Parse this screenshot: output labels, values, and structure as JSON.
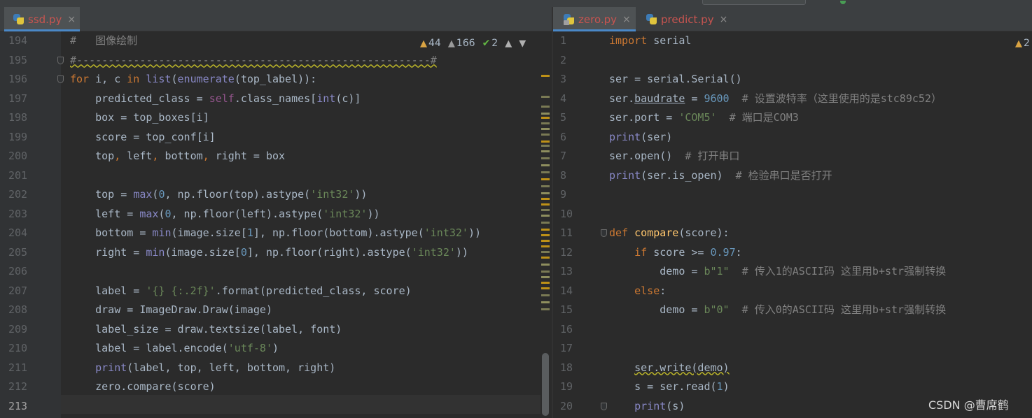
{
  "left_pane": {
    "tab": {
      "label": "ssd.py",
      "close": "×"
    },
    "inspections": {
      "warnings": "44",
      "weak_warnings": "166",
      "typos": "2"
    },
    "line_numbers": [
      "194",
      "195",
      "196",
      "197",
      "198",
      "199",
      "200",
      "201",
      "202",
      "203",
      "204",
      "205",
      "206",
      "207",
      "208",
      "209",
      "210",
      "211",
      "212",
      "213"
    ],
    "lines": [
      [
        {
          "t": "#   图像绘制",
          "c": "cm"
        }
      ],
      [
        {
          "t": "#--------------------------------------------------------#",
          "c": "cm sq"
        }
      ],
      [
        {
          "t": "for",
          "c": "kw"
        },
        {
          "t": " i, c "
        },
        {
          "t": "in",
          "c": "kw"
        },
        {
          "t": " "
        },
        {
          "t": "list",
          "c": "bi"
        },
        {
          "t": "("
        },
        {
          "t": "enumerate",
          "c": "bi"
        },
        {
          "t": "(top_label)):"
        }
      ],
      [
        {
          "t": "    predicted_class = "
        },
        {
          "t": "self",
          "c": "slf"
        },
        {
          "t": ".class_names["
        },
        {
          "t": "int",
          "c": "bi"
        },
        {
          "t": "(c)]"
        }
      ],
      [
        {
          "t": "    box = top_boxes[i]"
        }
      ],
      [
        {
          "t": "    score = top_conf[i]"
        }
      ],
      [
        {
          "t": "    top"
        },
        {
          "t": ",",
          "c": "kw"
        },
        {
          "t": " left"
        },
        {
          "t": ",",
          "c": "kw"
        },
        {
          "t": " bottom"
        },
        {
          "t": ",",
          "c": "kw"
        },
        {
          "t": " right = box"
        }
      ],
      [],
      [
        {
          "t": "    top = "
        },
        {
          "t": "max",
          "c": "bi"
        },
        {
          "t": "("
        },
        {
          "t": "0",
          "c": "num"
        },
        {
          "t": ","
        },
        {
          "t": " np.floor(top).astype("
        },
        {
          "t": "'int32'",
          "c": "str"
        },
        {
          "t": "))"
        }
      ],
      [
        {
          "t": "    left = "
        },
        {
          "t": "max",
          "c": "bi"
        },
        {
          "t": "("
        },
        {
          "t": "0",
          "c": "num"
        },
        {
          "t": ","
        },
        {
          "t": " np.floor(left).astype("
        },
        {
          "t": "'int32'",
          "c": "str"
        },
        {
          "t": "))"
        }
      ],
      [
        {
          "t": "    bottom = "
        },
        {
          "t": "min",
          "c": "bi"
        },
        {
          "t": "(image.size["
        },
        {
          "t": "1",
          "c": "num"
        },
        {
          "t": "],"
        },
        {
          "t": " np.floor(bottom).astype("
        },
        {
          "t": "'int32'",
          "c": "str"
        },
        {
          "t": "))"
        }
      ],
      [
        {
          "t": "    right = "
        },
        {
          "t": "min",
          "c": "bi"
        },
        {
          "t": "(image.size["
        },
        {
          "t": "0",
          "c": "num"
        },
        {
          "t": "],"
        },
        {
          "t": " np.floor(right).astype("
        },
        {
          "t": "'int32'",
          "c": "str"
        },
        {
          "t": "))"
        }
      ],
      [],
      [
        {
          "t": "    label = "
        },
        {
          "t": "'{} {:.2f}'",
          "c": "str"
        },
        {
          "t": ".format(predicted_class, score)"
        }
      ],
      [
        {
          "t": "    draw = ImageDraw.Draw(image)"
        }
      ],
      [
        {
          "t": "    label_size = draw.textsize(label, font)"
        }
      ],
      [
        {
          "t": "    label = label.encode("
        },
        {
          "t": "'utf-8'",
          "c": "str"
        },
        {
          "t": ")"
        }
      ],
      [
        {
          "t": "    "
        },
        {
          "t": "print",
          "c": "bi"
        },
        {
          "t": "(label, top, left, bottom, right)"
        }
      ],
      [
        {
          "t": "    zero.compare(score)"
        }
      ],
      []
    ]
  },
  "right_pane": {
    "tabs": [
      {
        "label": "zero.py",
        "close": "×"
      },
      {
        "label": "predict.py",
        "close": "×"
      }
    ],
    "inspections": {
      "warnings": "2"
    },
    "line_numbers": [
      "1",
      "2",
      "3",
      "4",
      "5",
      "6",
      "7",
      "8",
      "9",
      "10",
      "11",
      "12",
      "13",
      "14",
      "15",
      "16",
      "17",
      "18",
      "19",
      "20"
    ],
    "lines": [
      [
        {
          "t": "import",
          "c": "kw"
        },
        {
          "t": " serial"
        }
      ],
      [],
      [
        {
          "t": "ser = serial.Serial()"
        }
      ],
      [
        {
          "t": "ser."
        },
        {
          "t": "baudrate",
          "c": "ul"
        },
        {
          "t": " = "
        },
        {
          "t": "9600",
          "c": "num"
        },
        {
          "t": "  # 设置波特率（这里使用的是stc89c52）",
          "c": "cm"
        }
      ],
      [
        {
          "t": "ser.port = "
        },
        {
          "t": "'COM5'",
          "c": "str"
        },
        {
          "t": "  # 端口是COM3",
          "c": "cm"
        }
      ],
      [
        {
          "t": "print",
          "c": "bi"
        },
        {
          "t": "(ser)"
        }
      ],
      [
        {
          "t": "ser.open()"
        },
        {
          "t": "  # 打开串口",
          "c": "cm"
        }
      ],
      [
        {
          "t": "print",
          "c": "bi"
        },
        {
          "t": "(ser.is_open)"
        },
        {
          "t": "  # 检验串口是否打开",
          "c": "cm"
        }
      ],
      [],
      [],
      [
        {
          "t": "def",
          "c": "kw"
        },
        {
          "t": " "
        },
        {
          "t": "compare",
          "c": "fn"
        },
        {
          "t": "(score):"
        }
      ],
      [
        {
          "t": "    "
        },
        {
          "t": "if",
          "c": "kw"
        },
        {
          "t": " score >= "
        },
        {
          "t": "0.97",
          "c": "num"
        },
        {
          "t": ":"
        }
      ],
      [
        {
          "t": "        demo = "
        },
        {
          "t": "b\"1\"",
          "c": "str"
        },
        {
          "t": "  # 传入1的ASCII码 这里用b+str强制转换",
          "c": "cm"
        }
      ],
      [
        {
          "t": "    "
        },
        {
          "t": "else",
          "c": "kw"
        },
        {
          "t": ":"
        }
      ],
      [
        {
          "t": "        demo = "
        },
        {
          "t": "b\"0\"",
          "c": "str"
        },
        {
          "t": "  # 传入0的ASCII码 这里用b+str强制转换",
          "c": "cm"
        }
      ],
      [],
      [],
      [
        {
          "t": "    "
        },
        {
          "t": "ser.write(demo)",
          "c": "sq"
        }
      ],
      [
        {
          "t": "    s = ser.read("
        },
        {
          "t": "1",
          "c": "num"
        },
        {
          "t": ")"
        }
      ],
      [
        {
          "t": "    "
        },
        {
          "t": "print",
          "c": "bi"
        },
        {
          "t": "(s)"
        }
      ]
    ]
  },
  "watermark": "CSDN @曹席鹤",
  "colors": {
    "keyword": "#cc7832",
    "string": "#6a8759",
    "number": "#6897bb",
    "comment": "#808080",
    "builtin": "#8888c6",
    "self": "#94558d",
    "function": "#ffc66d",
    "tab_error": "#c75450"
  }
}
